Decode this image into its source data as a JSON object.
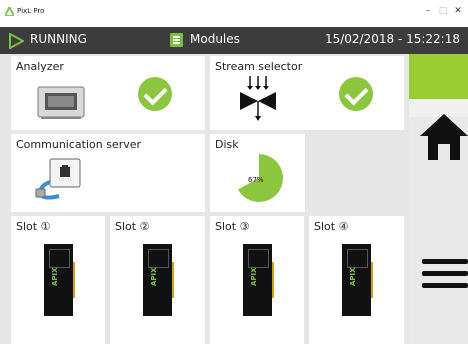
{
  "window": {
    "title": "PixL Pro",
    "controls": [
      "–",
      "□",
      "✕"
    ]
  },
  "statusbar": {
    "state": "RUNNING",
    "section": "Modules",
    "datetime": "15/02/2018 - 15:22:18"
  },
  "modules": {
    "analyzer": {
      "label": "Analyzer",
      "status": "ok"
    },
    "stream_selector": {
      "label": "Stream selector",
      "status": "ok"
    },
    "communication_server": {
      "label": "Communication server"
    },
    "disk": {
      "label": "Disk",
      "usage_label": "67%",
      "usage_fraction": 0.67
    }
  },
  "slots": [
    {
      "label": "Slot ①",
      "card_text": "APIX"
    },
    {
      "label": "Slot ②",
      "card_text": "APIX"
    },
    {
      "label": "Slot ③",
      "card_text": "APIX"
    },
    {
      "label": "Slot ④",
      "card_text": "APIX"
    }
  ],
  "colors": {
    "accent": "#8cc63f",
    "statusbar": "#3c3c3c"
  }
}
